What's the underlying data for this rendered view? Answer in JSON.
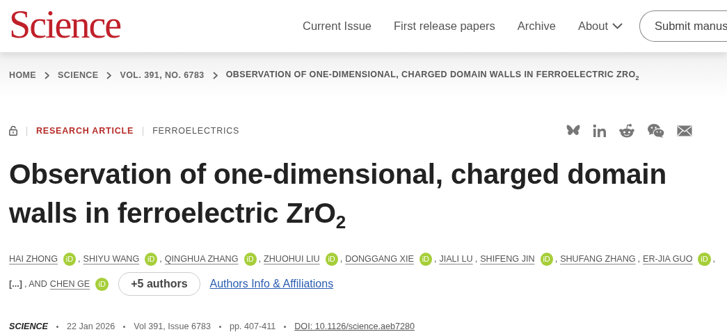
{
  "header": {
    "logo": "Science",
    "nav": [
      {
        "label": "Current Issue",
        "dropdown": false
      },
      {
        "label": "First release papers",
        "dropdown": false
      },
      {
        "label": "Archive",
        "dropdown": false
      },
      {
        "label": "About",
        "dropdown": true
      }
    ],
    "submit_button": "Submit manus"
  },
  "breadcrumb": [
    "HOME",
    "SCIENCE",
    "VOL. 391, NO. 6783",
    "OBSERVATION OF ONE-DIMENSIONAL, CHARGED DOMAIN WALLS IN FERROELECTRIC ZRO$_{2}$"
  ],
  "article": {
    "locked": false,
    "type": "RESEARCH ARTICLE",
    "subject": "FERROELECTRICS",
    "share": [
      {
        "kind": "bluesky"
      },
      {
        "kind": "linkedin"
      },
      {
        "kind": "reddit"
      },
      {
        "kind": "wechat"
      },
      {
        "kind": "email"
      }
    ],
    "title": "Observation of one-dimensional, charged domain walls in ferroelectric ZrO$_{2}$",
    "authors": {
      "lines": [
        [
          {
            "kind": "author",
            "name": "HAI ZHONG",
            "orcid": "iD",
            "after": ","
          },
          {
            "kind": "author",
            "name": "SHIYU WANG",
            "orcid": "iD",
            "after": ","
          },
          {
            "kind": "author",
            "name": "QINGHUA ZHANG",
            "orcid": "iD",
            "after": ","
          },
          {
            "kind": "author",
            "name": "ZHUOHUI LIU",
            "orcid": "iD",
            "after": ","
          },
          {
            "kind": "author",
            "name": "DONGGANG XIE",
            "orcid": "iD",
            "after": ","
          },
          {
            "kind": "author",
            "name": "JIALI LU",
            "after": ","
          },
          {
            "kind": "author",
            "name": "SHIFENG JIN",
            "orcid": "iD",
            "after": ","
          },
          {
            "kind": "author",
            "name": "SHUFANG ZHANG",
            "after": ","
          },
          {
            "kind": "author",
            "name": "ER-JIA GUO",
            "orcid": "iD",
            "after": ","
          }
        ],
        [
          {
            "kind": "more",
            "name": "[...]",
            "after": ", AND"
          },
          {
            "kind": "author",
            "name": "CHEN GE",
            "orcid": "iD"
          }
        ]
      ],
      "more_button": "+5 authors",
      "info_link": "Authors Info & Affiliations"
    },
    "meta": [
      {
        "kind": "journal",
        "text": "SCIENCE"
      },
      {
        "kind": "plain",
        "text": "22 Jan 2026"
      },
      {
        "kind": "plain",
        "text": "Vol 391, Issue 6783"
      },
      {
        "kind": "plain",
        "text": "pp. 407-411"
      },
      {
        "kind": "link",
        "text": "DOI: 10.1126/science.aeb7280"
      }
    ]
  }
}
